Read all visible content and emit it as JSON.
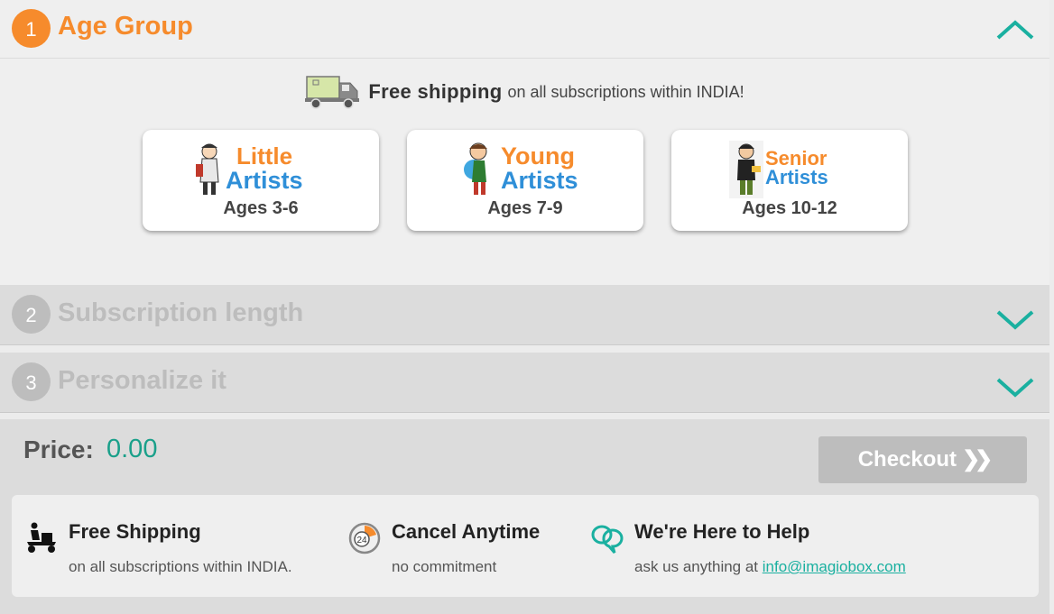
{
  "steps": [
    {
      "num": "1",
      "title": "Age Group",
      "state": "open"
    },
    {
      "num": "2",
      "title": "Subscription length",
      "state": "collapsed"
    },
    {
      "num": "3",
      "title": "Personalize it",
      "state": "collapsed"
    }
  ],
  "shipping_banner": {
    "strong": "Free shipping",
    "rest": "on all subscriptions within INDIA!",
    "icon": "delivery-truck-icon"
  },
  "age_cards": [
    {
      "logo_line1": "Little",
      "logo_line2": "Artists",
      "ages": "Ages 3-6",
      "icon": "little-artist-kid-icon"
    },
    {
      "logo_line1": "Young",
      "logo_line2": "Artists",
      "ages": "Ages 7-9",
      "icon": "young-artist-kid-icon"
    },
    {
      "logo_line1": "Senior",
      "logo_line2": "Artists",
      "ages": "Ages 10-12",
      "icon": "senior-artist-kid-icon"
    }
  ],
  "price": {
    "label": "Price:",
    "value": "0.00"
  },
  "checkout": {
    "label": "Checkout",
    "arrows": "❯❯"
  },
  "info": [
    {
      "title": "Free Shipping",
      "sub": "on all subscriptions within INDIA.",
      "icon": "scooter-delivery-icon"
    },
    {
      "title": "Cancel Anytime",
      "sub": "no commitment",
      "icon": "cancel-clock-icon"
    },
    {
      "title": "We're Here to Help",
      "sub_prefix": "ask us anything at",
      "email": "info@imagiobox.com",
      "icon": "help-bubble-icon"
    }
  ],
  "colors": {
    "accent": "#f68b2c",
    "teal": "#1ab0a0",
    "price": "#1aa08a",
    "blue": "#2f8fd8",
    "disabled": "#bdbdbd"
  }
}
